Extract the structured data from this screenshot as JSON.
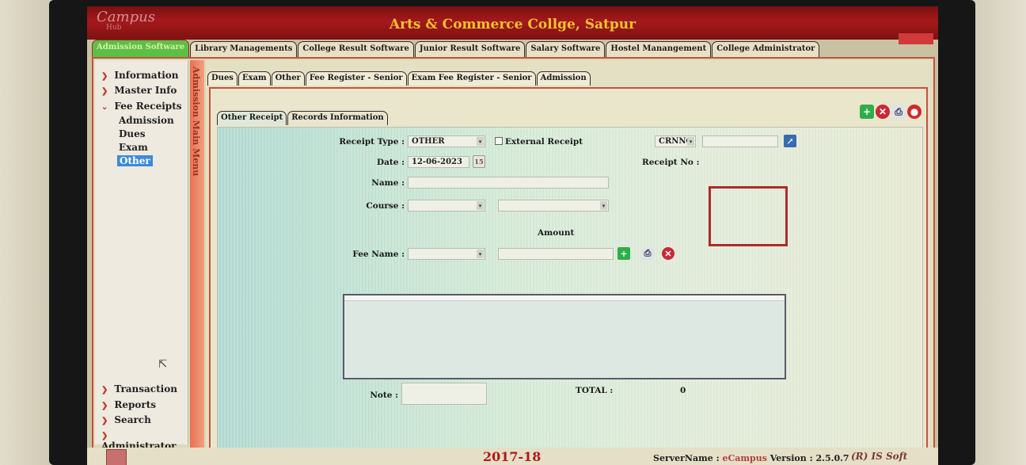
{
  "app": {
    "title": "Arts & Commerce Collge, Satpur",
    "logo": "Campus",
    "logo_sub": "Hub"
  },
  "module_tabs": [
    {
      "label": "Admission Software",
      "active": true
    },
    {
      "label": "Library Managements"
    },
    {
      "label": "College Result Software"
    },
    {
      "label": "Junior Result Software"
    },
    {
      "label": "Salary Software"
    },
    {
      "label": "Hostel Manangement"
    },
    {
      "label": "College Administrator"
    }
  ],
  "sidebar": {
    "vertical_title": "Admission Main Menu",
    "items": [
      "Information",
      "Master Info",
      "Fee Receipts"
    ],
    "sub_items": [
      "Admission",
      "Dues",
      "Exam",
      "Other"
    ],
    "selected_sub": "Other",
    "bottom_items": [
      "Transaction",
      "Reports",
      "Search",
      "Administrator"
    ]
  },
  "sub_tabs": [
    "Dues",
    "Exam",
    "Other",
    "Fee Register - Senior",
    "Exam Fee Register - Senior",
    "Admission"
  ],
  "receipt_tabs": [
    "Other Receipt",
    "Records Information"
  ],
  "form": {
    "receipt_type_label": "Receipt Type :",
    "receipt_type_value": "OTHER",
    "external_receipt_label": "External Receipt",
    "crnno_label": "CRNNO",
    "date_label": "Date :",
    "date_value": "12-06-2023",
    "receipt_no_label": "Receipt No :",
    "name_label": "Name :",
    "course_label": "Course :",
    "amount_label": "Amount",
    "fee_name_label": "Fee Name :",
    "note_label": "Note :",
    "total_label": "TOTAL :",
    "total_value": "0"
  },
  "footer": {
    "year": "2017-18",
    "server_label": "ServerName :",
    "server_value": "eCampus",
    "version_label": "Version : 2.5.0.7",
    "brand": "(R) IS Soft"
  },
  "colors": {
    "titlebar": "#a5191b",
    "title_text": "#f2c230",
    "accent_border": "#c4533c",
    "selected": "#3c8ad8"
  }
}
